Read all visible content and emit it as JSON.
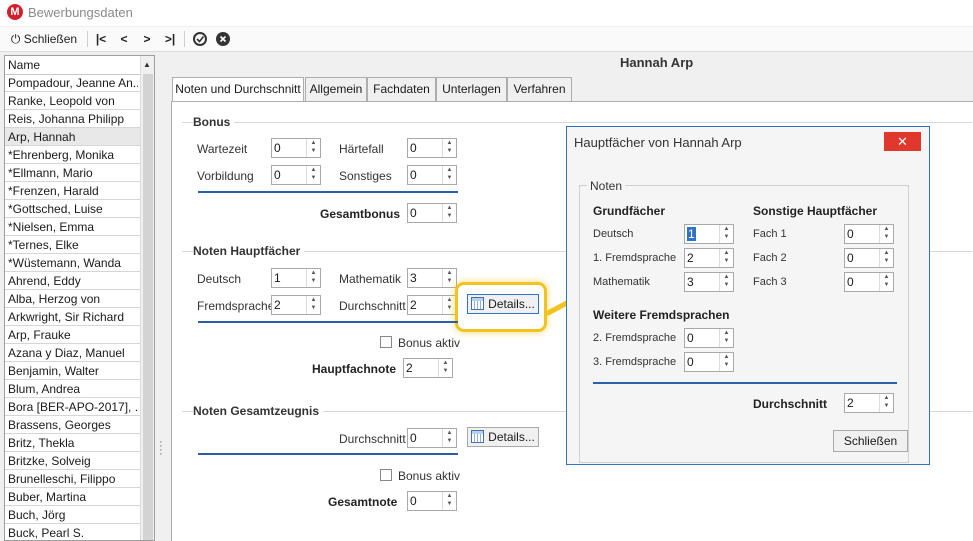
{
  "window": {
    "title": "Bewerbungsdaten",
    "app_icon_letter": "M"
  },
  "toolbar": {
    "close_label": "Schließen",
    "first_label": "|<",
    "prev_label": "<",
    "next_label": ">",
    "last_label": ">|"
  },
  "list": {
    "header": "Name",
    "rows": [
      "Pompadour, Jeanne An...",
      "Ranke, Leopold von",
      "Reis, Johanna Philipp",
      "Arp, Hannah",
      "*Ehrenberg, Monika",
      "*Ellmann, Mario",
      "*Frenzen, Harald",
      "*Gottsched, Luise",
      "*Nielsen, Emma",
      "*Ternes, Elke",
      "*Wüstemann, Wanda",
      "Ahrend, Eddy",
      "Alba, Herzog von",
      "Arkwright, Sir Richard",
      "Arp, Frauke",
      "Azana y Diaz, Manuel",
      "Benjamin, Walter",
      "Blum, Andrea",
      "Bora [BER-APO-2017], ...",
      "Brassens, Georges",
      "Britz, Thekla",
      "Britzke, Solveig",
      "Brunelleschi, Filippo",
      "Buber, Martina",
      "Buch, Jörg",
      "Buck, Pearl S."
    ],
    "selected_index": 3
  },
  "student_name": "Hannah Arp",
  "tabs": [
    "Noten und Durchschnitt",
    "Allgemein",
    "Fachdaten",
    "Unterlagen",
    "Verfahren"
  ],
  "bonus": {
    "title": "Bonus",
    "wartezeit_label": "Wartezeit",
    "wartezeit": "0",
    "haertefall_label": "Härtefall",
    "haertefall": "0",
    "vorbildung_label": "Vorbildung",
    "vorbildung": "0",
    "sonstiges_label": "Sonstiges",
    "sonstiges": "0",
    "gesamt_label": "Gesamtbonus",
    "gesamt": "0"
  },
  "haupt": {
    "title": "Noten Hauptfächer",
    "deutsch_label": "Deutsch",
    "deutsch": "1",
    "mathe_label": "Mathematik",
    "mathe": "3",
    "fremd_label": "Fremdsprache",
    "fremd": "2",
    "schnitt_label": "Durchschnitt",
    "schnitt": "2",
    "details_label": "Details...",
    "bonus_label": "Bonus aktiv",
    "note_label": "Hauptfachnote",
    "note": "2"
  },
  "gesamt": {
    "title": "Noten Gesamtzeugnis",
    "schnitt_label": "Durchschnitt",
    "schnitt": "0",
    "details_label": "Details...",
    "bonus_label": "Bonus aktiv",
    "note_label": "Gesamtnote",
    "note": "0"
  },
  "dialog": {
    "title": "Hauptfächer von Hannah Arp",
    "close_symbol": "✕",
    "group_caption": "Noten",
    "grund_title": "Grundfächer",
    "deutsch_label": "Deutsch",
    "deutsch": "1",
    "fremd1_label": "1. Fremdsprache",
    "fremd1": "2",
    "mathe_label": "Mathematik",
    "mathe": "3",
    "sonst_title": "Sonstige Hauptfächer",
    "fach1_label": "Fach 1",
    "fach1": "0",
    "fach2_label": "Fach 2",
    "fach2": "0",
    "fach3_label": "Fach 3",
    "fach3": "0",
    "weitere_title": "Weitere Fremdsprachen",
    "fremd2_label": "2. Fremdsprache",
    "fremd2": "0",
    "fremd3_label": "3. Fremdsprache",
    "fremd3": "0",
    "schnitt_label": "Durchschnitt",
    "schnitt": "2",
    "close_label": "Schließen"
  },
  "colors": {
    "accent": "#2f73c9",
    "highlight": "#f2c21f",
    "close_red": "#e0382d",
    "divider_blue": "#2b5fa8"
  }
}
